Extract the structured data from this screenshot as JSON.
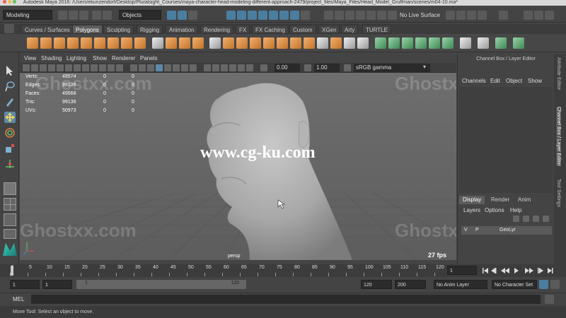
{
  "window": {
    "title": "Autodesk Maya 2016: /Users/ekunzendorf/Desktop/Pluralsight_Courses/maya-character-head-modeling-different-approach-2479/project_files/Maya_Files/Head_Model_Gruffman/scenes/m04-10.ma*"
  },
  "statusline": {
    "mode": "Modeling",
    "select_mode": "Objects",
    "live_surface": "No Live Surface"
  },
  "shelf_tabs": [
    {
      "label": "Curves / Surfaces"
    },
    {
      "label": "Polygons",
      "active": true
    },
    {
      "label": "Sculpting"
    },
    {
      "label": "Rigging"
    },
    {
      "label": "Animation"
    },
    {
      "label": "Rendering"
    },
    {
      "label": "FX"
    },
    {
      "label": "FX Caching"
    },
    {
      "label": "Custom"
    },
    {
      "label": "XGen"
    },
    {
      "label": "Arty"
    },
    {
      "label": "TURTLE"
    }
  ],
  "panel_menu": [
    "View",
    "Shading",
    "Lighting",
    "Show",
    "Renderer",
    "Panels"
  ],
  "panel_toolbar": {
    "exposure": "0.00",
    "gamma": "1.00",
    "color_space": "sRGB gamma"
  },
  "hud": {
    "rows": [
      {
        "label": "Verts:",
        "a": "49574",
        "b": "0",
        "c": "0"
      },
      {
        "label": "Edges:",
        "a": "99136",
        "b": "0",
        "c": "0"
      },
      {
        "label": "Faces:",
        "a": "49568",
        "b": "0",
        "c": "0"
      },
      {
        "label": "Tris:",
        "a": "99136",
        "b": "0",
        "c": "0"
      },
      {
        "label": "UVs:",
        "a": "50973",
        "b": "0",
        "c": "0"
      }
    ],
    "camera": "persp",
    "fps": "27 fps"
  },
  "overlay": {
    "site": "www.cg-ku.com",
    "watermark": "Ghostxx.com"
  },
  "right_panel": {
    "title": "Channel Box / Layer Editor",
    "menu": [
      "Channels",
      "Edit",
      "Object",
      "Show"
    ],
    "vertical_tabs": [
      "Attribute Editor",
      "Channel Box / Layer Editor",
      "Tool Settings"
    ],
    "layer_tabs": [
      "Display",
      "Render",
      "Anim"
    ],
    "layer_menu": [
      "Layers",
      "Options",
      "Help"
    ],
    "layer": {
      "v": "V",
      "p": "P",
      "name": "GeoLyr"
    }
  },
  "timeline": {
    "ticks": [
      "1",
      "5",
      "10",
      "15",
      "20",
      "25",
      "30",
      "35",
      "40",
      "45",
      "50",
      "55",
      "60",
      "65",
      "70",
      "75",
      "80",
      "85",
      "90",
      "95",
      "100",
      "105",
      "110",
      "115",
      "120"
    ],
    "current_frame": "1"
  },
  "range": {
    "start": "1",
    "playback_start": "1",
    "bar_start": "1",
    "bar_end": "120",
    "playback_end": "120",
    "end": "200",
    "anim_layer": "No Anim Layer",
    "char_set": "No Character Set"
  },
  "command_line": {
    "label": "MEL"
  },
  "help_line": "Move Tool: Select an object to move.",
  "colors": {
    "ui_bg": "#444444",
    "viewport_bg": "#6b6b6b",
    "accent": "#4a7ea0",
    "shelf_orange": "#e08a3c"
  }
}
